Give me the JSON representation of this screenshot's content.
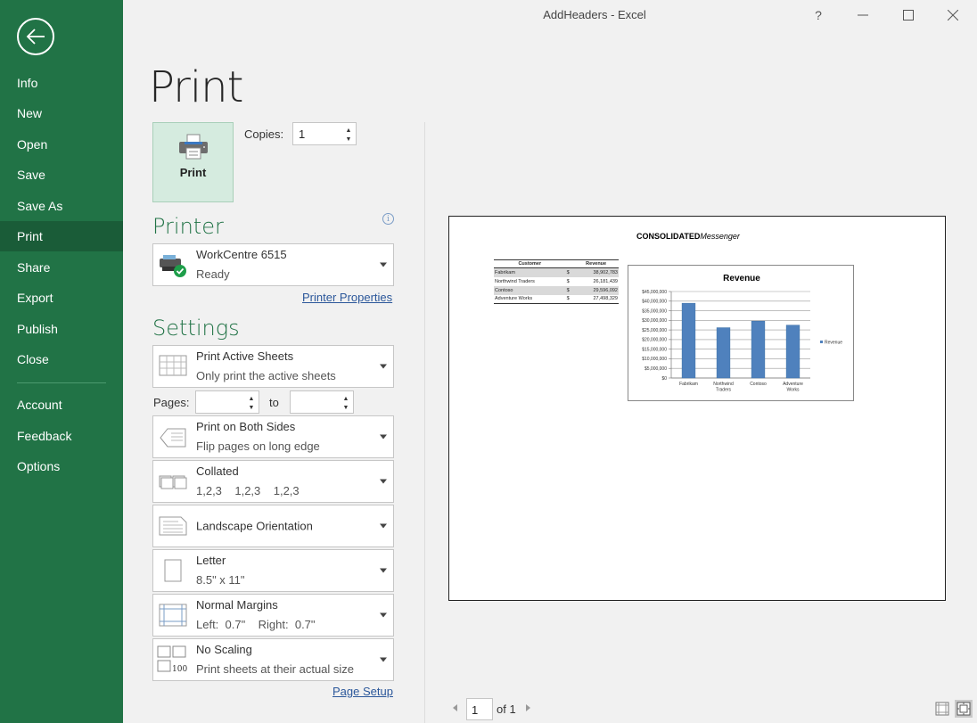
{
  "window": {
    "title": "AddHeaders  -  Excel",
    "help_label": "?",
    "minimize_label": "—",
    "maximize_label": "☐",
    "close_label": "✕"
  },
  "sidebar": {
    "back_icon": "back-arrow-icon",
    "items": [
      {
        "label": "Info"
      },
      {
        "label": "New"
      },
      {
        "label": "Open"
      },
      {
        "label": "Save"
      },
      {
        "label": "Save As"
      },
      {
        "label": "Print",
        "active": true
      },
      {
        "label": "Share"
      },
      {
        "label": "Export"
      },
      {
        "label": "Publish"
      },
      {
        "label": "Close"
      },
      {
        "label": "Account"
      },
      {
        "label": "Feedback"
      },
      {
        "label": "Options"
      }
    ]
  },
  "print": {
    "title": "Print",
    "button_label": "Print",
    "copies_label": "Copies:",
    "copies_value": "1"
  },
  "printer": {
    "heading": "Printer",
    "name": "WorkCentre 6515",
    "status": "Ready",
    "properties_link": "Printer Properties",
    "info_glyph": "i"
  },
  "settings": {
    "heading": "Settings",
    "what_to_print": {
      "title": "Print Active Sheets",
      "subtitle": "Only print the active sheets"
    },
    "pages_label": "Pages:",
    "pages_from": "",
    "to_label": "to",
    "pages_to": "",
    "sides": {
      "title": "Print on Both Sides",
      "subtitle": "Flip pages on long edge"
    },
    "collation": {
      "title": "Collated",
      "subtitle": "1,2,3    1,2,3    1,2,3"
    },
    "orientation": {
      "title": "Landscape Orientation"
    },
    "paper": {
      "title": "Letter",
      "subtitle": "8.5\" x 11\""
    },
    "margins": {
      "title": "Normal Margins",
      "subtitle": "Left:  0.7\"    Right:  0.7\""
    },
    "scaling": {
      "title": "No Scaling",
      "subtitle": "Print sheets at their actual size",
      "icon_text": "100"
    },
    "page_setup_link": "Page Setup"
  },
  "preview": {
    "header_bold": "CONSOLIDATED",
    "header_italic": "Messenger",
    "table": {
      "headers": [
        "Customer",
        "Revenue"
      ],
      "rows": [
        {
          "customer": "Fabrikam",
          "currency": "$",
          "revenue": "38,902,783"
        },
        {
          "customer": "Northwind Traders",
          "currency": "$",
          "revenue": "26,181,439"
        },
        {
          "customer": "Contoso",
          "currency": "$",
          "revenue": "29,596,092"
        },
        {
          "customer": "Adventure Works",
          "currency": "$",
          "revenue": "27,498,329"
        }
      ]
    },
    "page_current": "1",
    "page_of": "of 1"
  },
  "chart_data": {
    "type": "bar",
    "title": "Revenue",
    "categories": [
      "Fabrikam",
      "Northwind Traders",
      "Contoso",
      "Adventure Works"
    ],
    "category_lines": [
      [
        "Fabrikam"
      ],
      [
        "Northwind",
        "Traders"
      ],
      [
        "Contoso"
      ],
      [
        "Adventure",
        "Works"
      ]
    ],
    "series": [
      {
        "name": "Revenue",
        "values": [
          38902783,
          26181439,
          29596092,
          27498329
        ]
      }
    ],
    "ylim": [
      0,
      45000000
    ],
    "yticks": [
      0,
      5000000,
      10000000,
      15000000,
      20000000,
      25000000,
      30000000,
      35000000,
      40000000,
      45000000
    ],
    "ytick_labels": [
      "$0",
      "$5,000,000",
      "$10,000,000",
      "$15,000,000",
      "$20,000,000",
      "$25,000,000",
      "$30,000,000",
      "$35,000,000",
      "$40,000,000",
      "$45,000,000"
    ],
    "grid": true,
    "legend": "right",
    "bar_color": "#4f81bd",
    "xlabel": "",
    "ylabel": ""
  }
}
